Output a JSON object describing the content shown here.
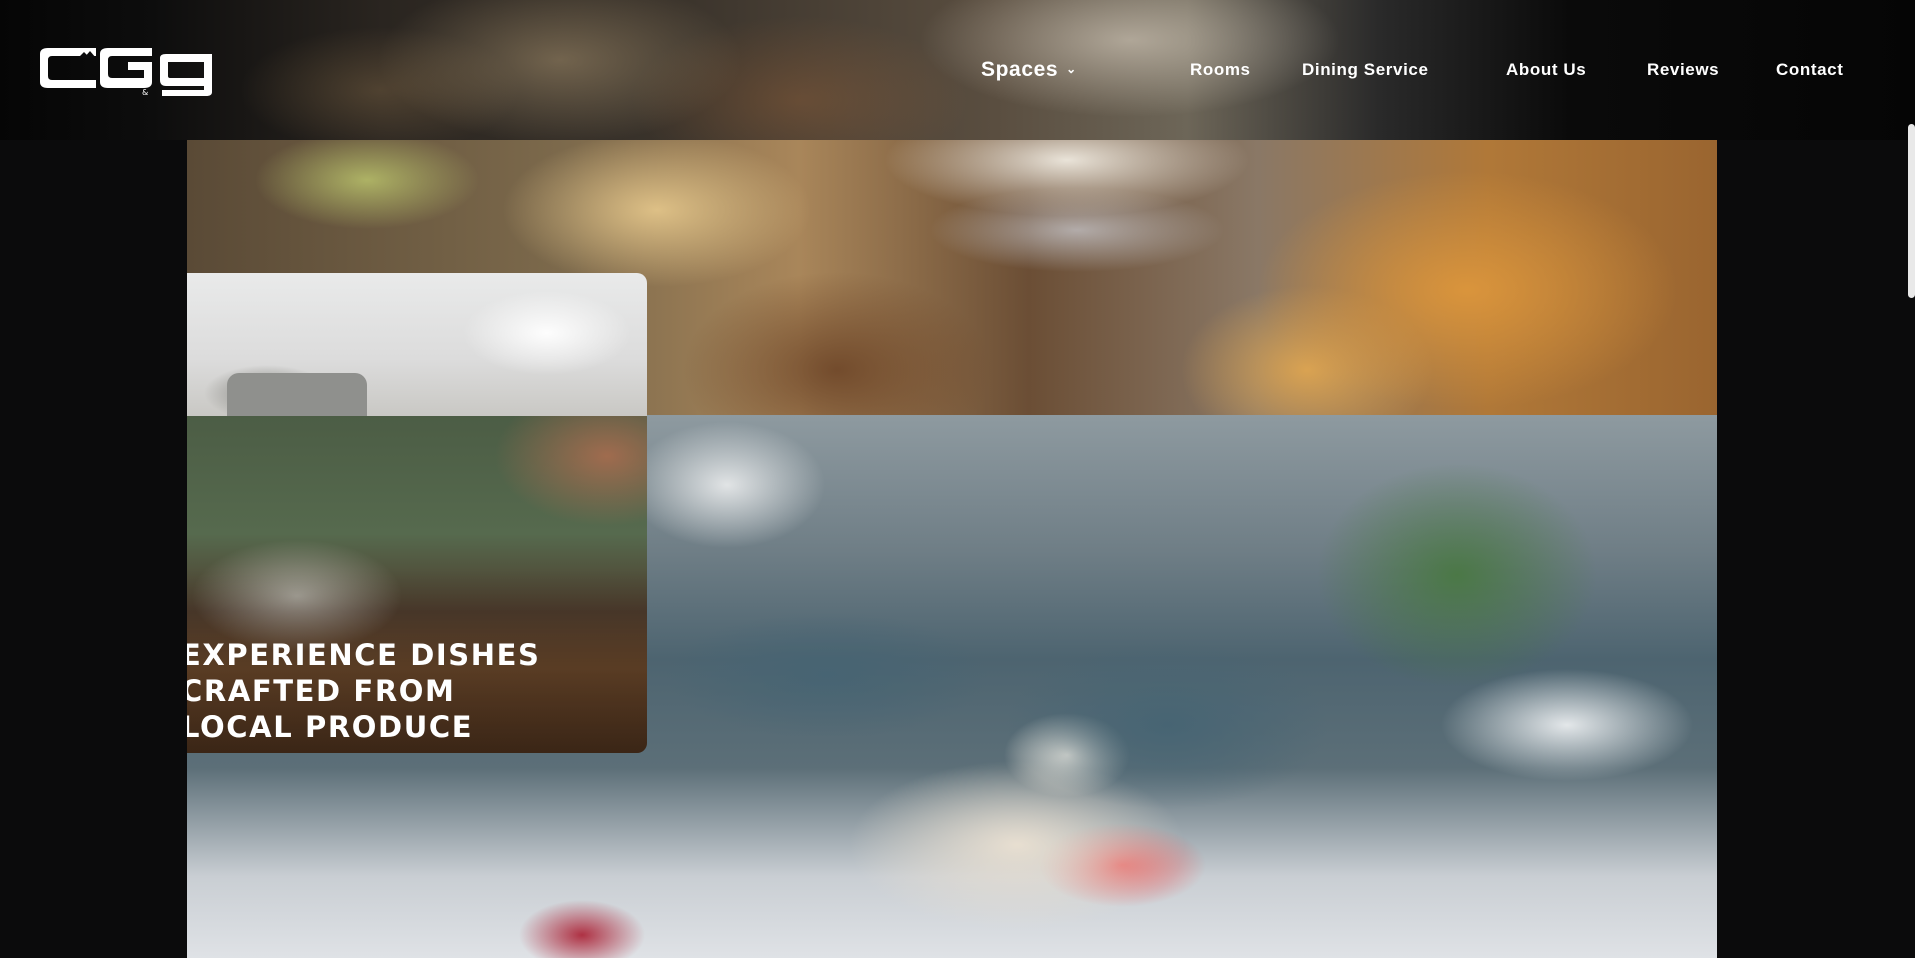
{
  "header": {
    "logo": {
      "icon": "cgg-logo-icon",
      "text": "CGg",
      "small_text": "&"
    },
    "nav": {
      "spaces": {
        "label": "Spaces",
        "icon": "chevron-down-icon"
      },
      "rooms": "Rooms",
      "dining": "Dining Service",
      "about": "About Us",
      "reviews": "Reviews",
      "contact": "Contact"
    }
  },
  "hero": {
    "headline": [
      "EXPERIENCE DISHES",
      "CRAFTED FROM",
      "LOCAL PRODUCE"
    ]
  },
  "images": {
    "top": "food-buffet-image",
    "teapot": "teapot-image",
    "dish": "dessert-cup-image",
    "restaurant": "restaurant-dessert-platter-image"
  }
}
